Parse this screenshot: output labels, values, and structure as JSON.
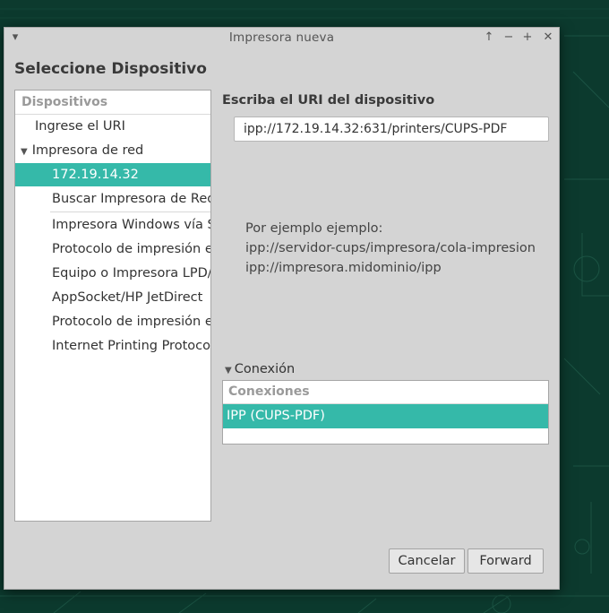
{
  "window": {
    "title": "Impresora nueva",
    "menu_icon": "triangle-down-icon",
    "controls": [
      "arrow-up-icon",
      "minimize-icon",
      "maximize-icon",
      "close-icon"
    ]
  },
  "heading": "Seleccione Dispositivo",
  "devices": {
    "header": "Dispositivos",
    "items": [
      {
        "label": "Ingrese el URI"
      },
      {
        "label": "Impresora de red"
      },
      {
        "label": "172.19.14.32",
        "selected": true
      },
      {
        "label": "Buscar Impresora de Red"
      },
      {
        "label": "Impresora Windows vía SAMBA"
      },
      {
        "label": "Protocolo de impresión en Internet (https)"
      },
      {
        "label": "Equipo o Impresora LPD/LPR"
      },
      {
        "label": "AppSocket/HP JetDirect"
      },
      {
        "label": "Protocolo de impresión en Internet (ipps)"
      },
      {
        "label": "Internet Printing Protocol (ipp)"
      }
    ]
  },
  "uri": {
    "label": "Escriba el URI del dispositivo",
    "value": "ipp://172.19.14.32:631/printers/CUPS-PDF"
  },
  "example": {
    "line1": "Por ejemplo ejemplo:",
    "line2": "ipp://servidor-cups/impresora/cola-impresion",
    "line3": "ipp://impresora.midominio/ipp"
  },
  "connection": {
    "expander_label": "Conexión",
    "header": "Conexiones",
    "rows": [
      {
        "label": "IPP (CUPS-PDF)",
        "selected": true
      }
    ]
  },
  "buttons": {
    "cancel": "Cancelar",
    "forward": "Forward"
  },
  "colors": {
    "selection": "#35b9a9",
    "dialog_bg": "#d4d4d4",
    "desktop_bg": "#0c3a2e"
  }
}
